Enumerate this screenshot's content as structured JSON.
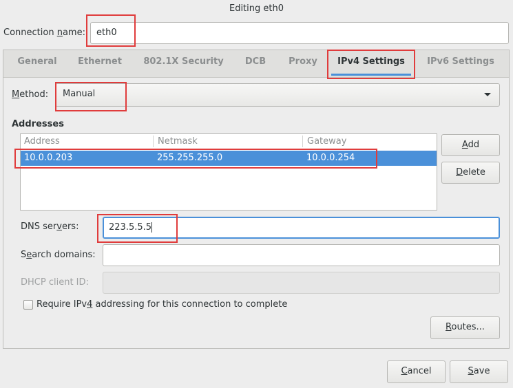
{
  "window": {
    "title": "Editing eth0"
  },
  "connection_name": {
    "label_pre": "Connection ",
    "label_u": "n",
    "label_post": "ame:",
    "value": "eth0"
  },
  "tabs": [
    {
      "label": "General",
      "active": false
    },
    {
      "label": "Ethernet",
      "active": false
    },
    {
      "label": "802.1X Security",
      "active": false
    },
    {
      "label": "DCB",
      "active": false
    },
    {
      "label": "Proxy",
      "active": false
    },
    {
      "label": "IPv4 Settings",
      "active": true
    },
    {
      "label": "IPv6 Settings",
      "active": false
    }
  ],
  "ipv4": {
    "method": {
      "label_u": "M",
      "label_post": "ethod:",
      "value": "Manual"
    },
    "addresses": {
      "heading": "Addresses",
      "columns": [
        "Address",
        "Netmask",
        "Gateway"
      ],
      "rows": [
        {
          "address": "10.0.0.203",
          "netmask": "255.255.255.0",
          "gateway": "10.0.0.254",
          "selected": true
        }
      ],
      "add_button": {
        "u": "A",
        "rest": "dd"
      },
      "delete_button": {
        "u": "D",
        "rest": "elete"
      }
    },
    "dns": {
      "label_pre": "DNS ser",
      "label_u": "v",
      "label_post": "ers:",
      "value": "223.5.5.5"
    },
    "search_domains": {
      "label_pre": "S",
      "label_u": "e",
      "label_post": "arch domains:",
      "value": ""
    },
    "dhcp_client_id": {
      "label": "DHCP client ID:",
      "value": ""
    },
    "require_ipv4": {
      "label_pre": "Require IPv",
      "label_u": "4",
      "label_post": " addressing for this connection to complete",
      "checked": false
    },
    "routes_button": {
      "u": "R",
      "rest": "outes..."
    }
  },
  "footer": {
    "cancel": {
      "u": "C",
      "rest": "ancel"
    },
    "save": {
      "u": "S",
      "rest": "ave"
    }
  },
  "colors": {
    "accent": "#4a90d9",
    "highlight_box": "#e03c3c"
  }
}
